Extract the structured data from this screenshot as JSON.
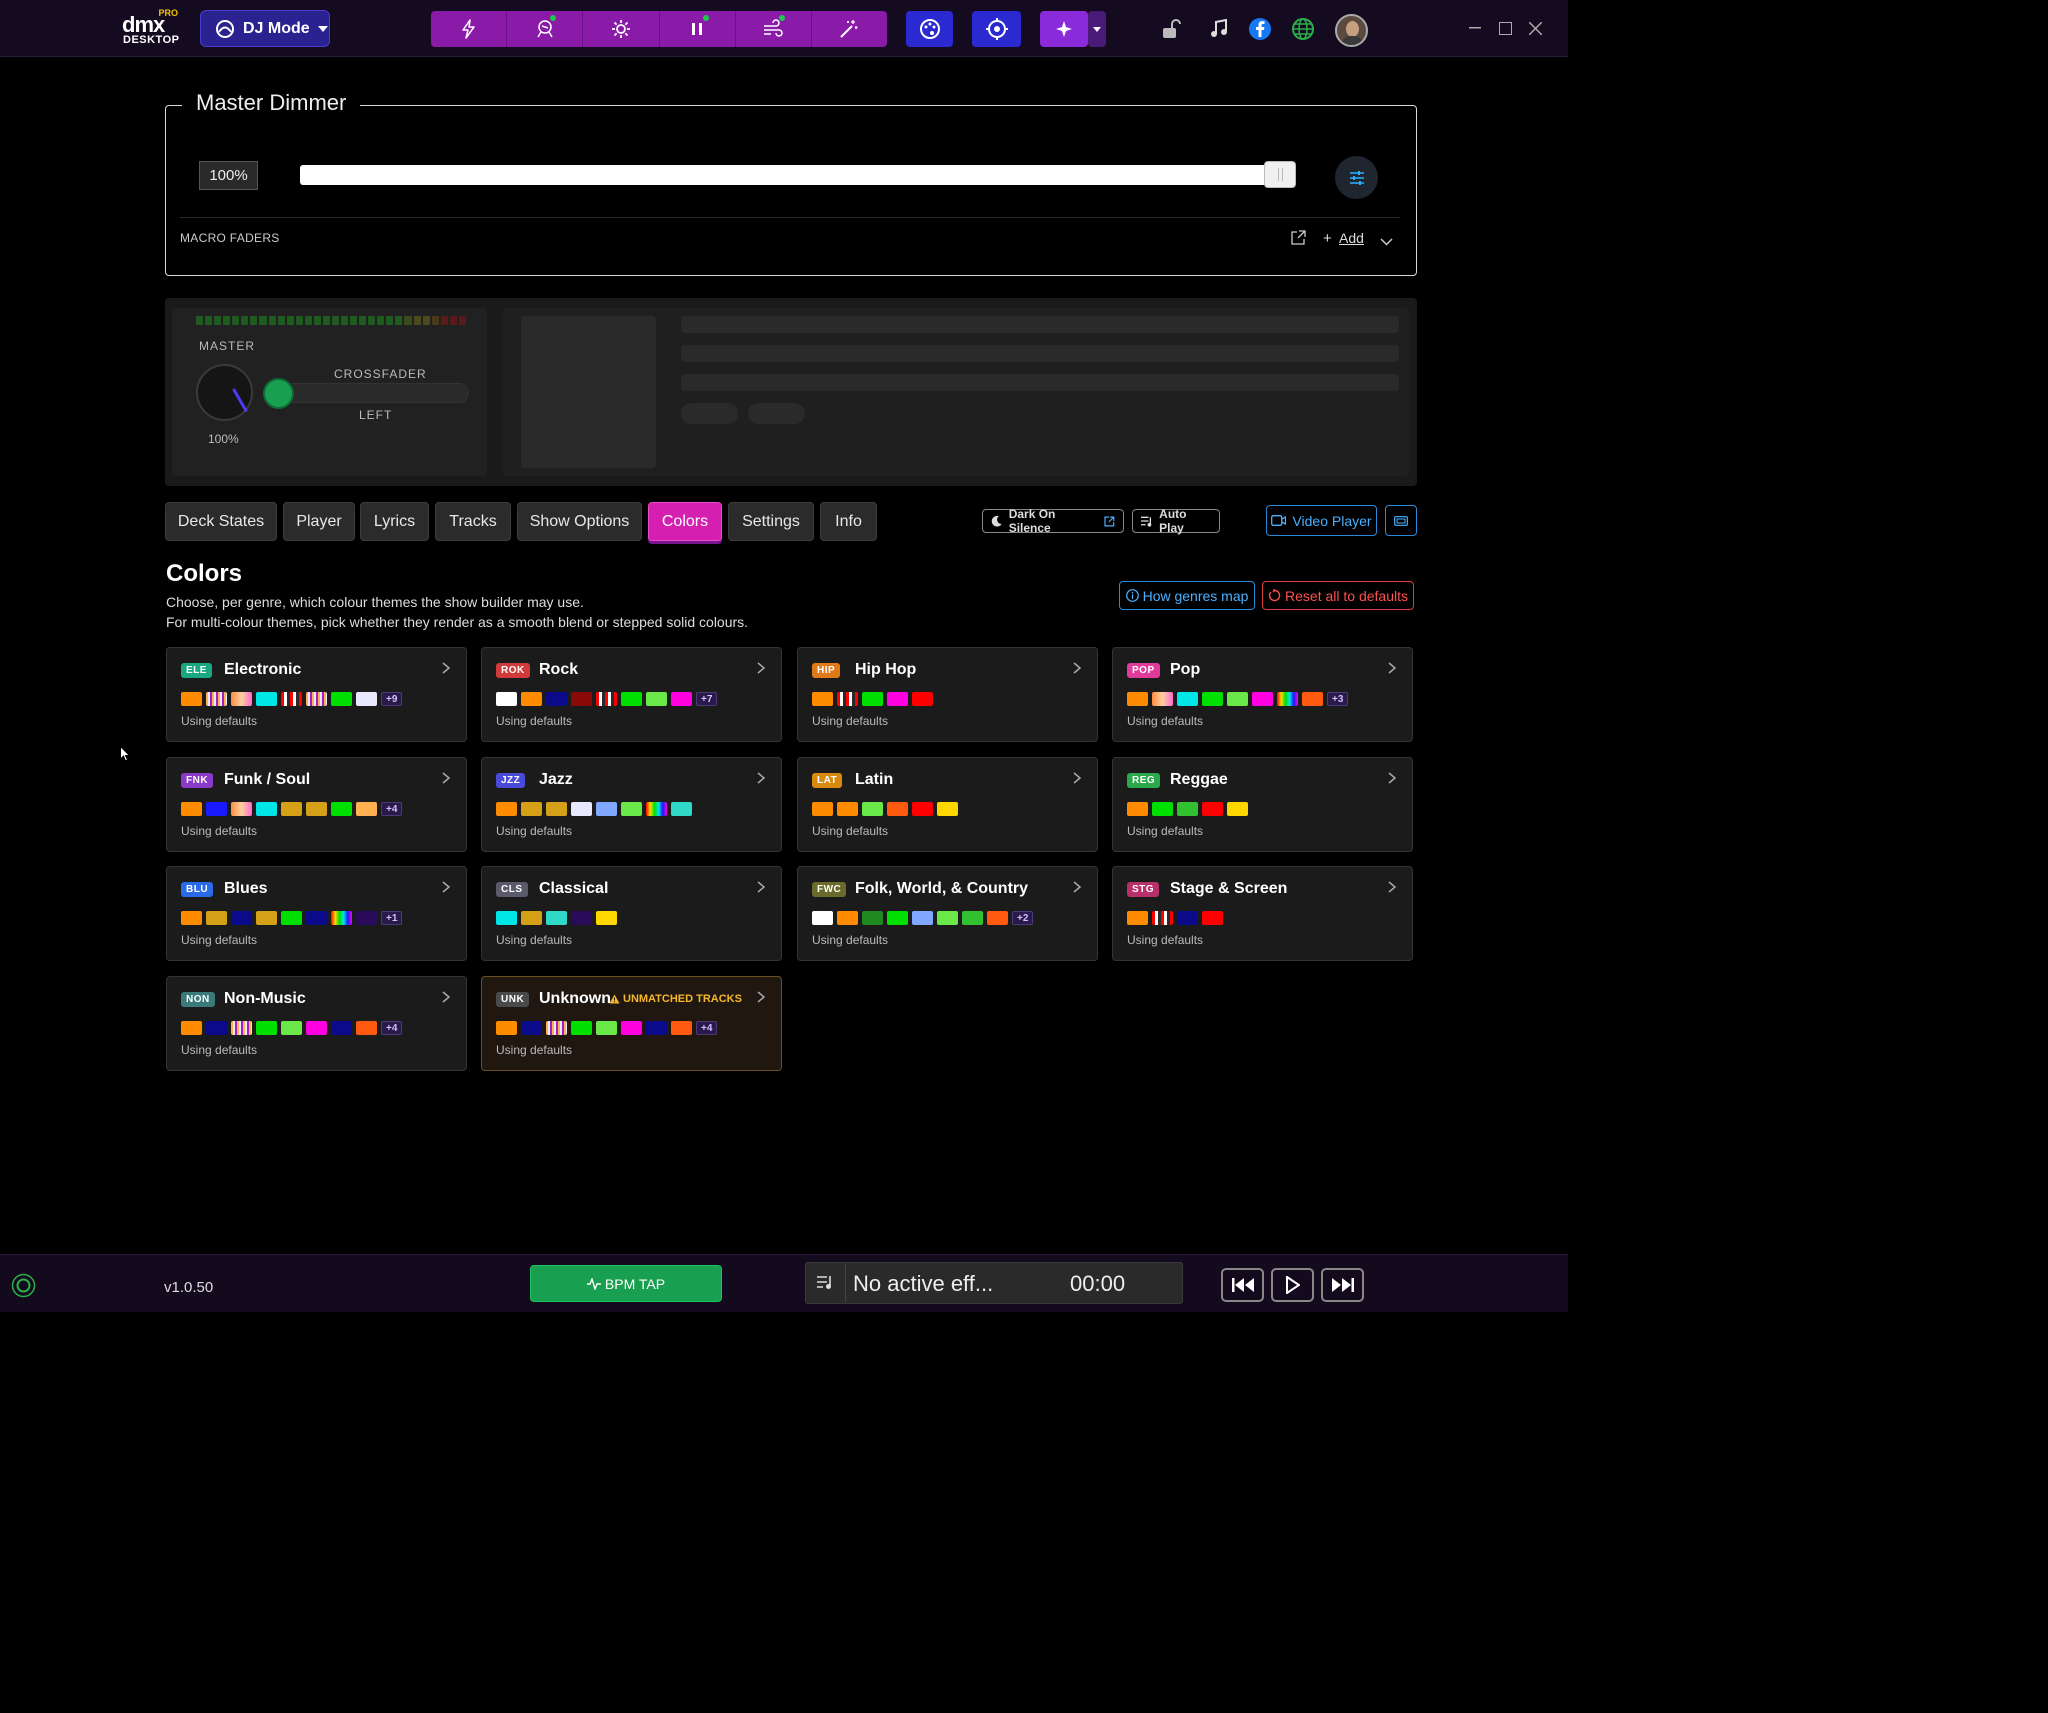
{
  "app": {
    "logo_pro": "PRO",
    "logo_dmx": "dmx",
    "logo_desktop": "DESKTOP",
    "mode_label": "DJ Mode",
    "version": "v1.0.50"
  },
  "toolbar": {
    "effects": [
      "bolt-icon",
      "spotlight-icon",
      "gear-light-icon",
      "pause-icon",
      "wind-icon",
      "magic-wand-icon"
    ],
    "effect_dots": [
      false,
      true,
      false,
      true,
      true,
      false
    ]
  },
  "dimmer": {
    "title": "Master Dimmer",
    "value_label": "100%",
    "level": 1.0,
    "macro_label": "MACRO FADERS",
    "add_label": "Add"
  },
  "mixer": {
    "master_label": "MASTER",
    "master_value": "100%",
    "crossfader_label": "CROSSFADER",
    "crossfader_position": "LEFT",
    "vu_colors": [
      "#1f5a1f",
      "#1f5a1f",
      "#1f5a1f",
      "#1f5a1f",
      "#1f5a1f",
      "#1f5a1f",
      "#1f5a1f",
      "#1f5a1f",
      "#1f5a1f",
      "#1f5a1f",
      "#1f5a1f",
      "#1f5a1f",
      "#1f5a1f",
      "#1f5a1f",
      "#1f5a1f",
      "#1f5a1f",
      "#1f5a1f",
      "#1f5a1f",
      "#1f5a1f",
      "#1f5a1f",
      "#1f5a1f",
      "#1f5a1f",
      "#1f5a1f",
      "#3a4a1a",
      "#4a4a1a",
      "#4a4a1a",
      "#4a3a1a",
      "#5a1a1a",
      "#5a1a1a",
      "#5a1a1a"
    ]
  },
  "tabs": [
    "Deck States",
    "Player",
    "Lyrics",
    "Tracks",
    "Show Options",
    "Colors",
    "Settings",
    "Info"
  ],
  "active_tab": "Colors",
  "actions": {
    "dark_on_silence": "Dark On Silence",
    "auto_play": "Auto Play",
    "video_player": "Video Player"
  },
  "colors": {
    "heading": "Colors",
    "desc1": "Choose, per genre, which colour themes the show builder may use.",
    "desc2": "For multi-colour themes, pick whether they render as a smooth blend or stepped solid colours.",
    "how_label": "How genres map",
    "reset_label": "Reset all to defaults",
    "genres": [
      {
        "code": "ELE",
        "name": "Electronic",
        "badge_color": "#1aa880",
        "swatches": [
          "#ff8c00",
          "stripe",
          "gradient-orange",
          "#00e5e5",
          "stripe-red",
          "stripe",
          "#00e000",
          "#e8e8ff"
        ],
        "more": "+9",
        "status": "Using defaults"
      },
      {
        "code": "ROK",
        "name": "Rock",
        "badge_color": "#d03a3a",
        "swatches": [
          "#ffffff",
          "#ff8c00",
          "#0a0a8a",
          "#8a0a0a",
          "stripe-red",
          "#00e000",
          "#6ae84a",
          "#ff00e0"
        ],
        "more": "+7",
        "status": "Using defaults"
      },
      {
        "code": "HIP",
        "name": "Hip Hop",
        "badge_color": "#e07a18",
        "swatches": [
          "#ff8c00",
          "stripe-red",
          "#00e000",
          "#ff00e0",
          "#ff0000"
        ],
        "more": "",
        "status": "Using defaults"
      },
      {
        "code": "POP",
        "name": "Pop",
        "badge_color": "#e03a9a",
        "swatches": [
          "#ff8c00",
          "gradient-orange",
          "#00e5e5",
          "#00e000",
          "#6ae84a",
          "#ff00e0",
          "rainbow",
          "#ff5a10"
        ],
        "more": "+3",
        "status": "Using defaults"
      },
      {
        "code": "FNK",
        "name": "Funk / Soul",
        "badge_color": "#8a3ac8",
        "swatches": [
          "#ff8c00",
          "#1a1aff",
          "gradient-orange",
          "#00e5e5",
          "#d4a017",
          "#d4a017",
          "#00e000",
          "#ffb050"
        ],
        "more": "+4",
        "status": "Using defaults"
      },
      {
        "code": "JZZ",
        "name": "Jazz",
        "badge_color": "#4a4ad8",
        "swatches": [
          "#ff8c00",
          "#d4a017",
          "#d4a017",
          "#e8e8ff",
          "#80a8ff",
          "#6ae84a",
          "rainbow",
          "#30d8c8"
        ],
        "more": "",
        "status": "Using defaults"
      },
      {
        "code": "LAT",
        "name": "Latin",
        "badge_color": "#d88a10",
        "swatches": [
          "#ff8c00",
          "#ff8c00",
          "#6ae84a",
          "#ff5a10",
          "#ff0000",
          "#ffd700"
        ],
        "more": "",
        "status": "Using defaults"
      },
      {
        "code": "REG",
        "name": "Reggae",
        "badge_color": "#2aa84a",
        "swatches": [
          "#ff8c00",
          "#00e000",
          "#30c030",
          "#ff0000",
          "#ffd700"
        ],
        "more": "",
        "status": "Using defaults"
      },
      {
        "code": "BLU",
        "name": "Blues",
        "badge_color": "#2a6ae8",
        "swatches": [
          "#ff8c00",
          "#d4a017",
          "#0a0a8a",
          "#d4a017",
          "#00e000",
          "#0a0a8a",
          "rainbow",
          "#2a0a5a"
        ],
        "more": "+1",
        "status": "Using defaults"
      },
      {
        "code": "CLS",
        "name": "Classical",
        "badge_color": "#5a5a6a",
        "swatches": [
          "#00e5e5",
          "#d4a017",
          "#30d8c8",
          "#2a0a5a",
          "#ffd700"
        ],
        "more": "",
        "status": "Using defaults"
      },
      {
        "code": "FWC",
        "name": "Folk, World, & Country",
        "badge_color": "#6a6a2a",
        "swatches": [
          "#ffffff",
          "#ff8c00",
          "#208a20",
          "#00e000",
          "#80a8ff",
          "#6ae84a",
          "#30c030",
          "#ff5a10"
        ],
        "more": "+2",
        "status": "Using defaults"
      },
      {
        "code": "STG",
        "name": "Stage & Screen",
        "badge_color": "#b8306a",
        "swatches": [
          "#ff8c00",
          "stripe-red",
          "#0a0a8a",
          "#ff0000"
        ],
        "more": "",
        "status": "Using defaults"
      },
      {
        "code": "NON",
        "name": "Non-Music",
        "badge_color": "#3a7a7a",
        "swatches": [
          "#ff8c00",
          "#0a0a8a",
          "stripe",
          "#00e000",
          "#6ae84a",
          "#ff00e0",
          "#0a0a8a",
          "#ff5a10"
        ],
        "more": "+4",
        "status": "Using defaults"
      },
      {
        "code": "UNK",
        "name": "Unknown",
        "badge_color": "#4a4a4a",
        "warning": "UNMATCHED TRACKS",
        "swatches": [
          "#ff8c00",
          "#0a0a8a",
          "stripe",
          "#00e000",
          "#6ae84a",
          "#ff00e0",
          "#0a0a8a",
          "#ff5a10"
        ],
        "more": "+4",
        "status": "Using defaults"
      }
    ]
  },
  "bottom": {
    "bpm_label": "BPM TAP",
    "effect_text": "No active eff...",
    "effect_time": "00:00"
  }
}
